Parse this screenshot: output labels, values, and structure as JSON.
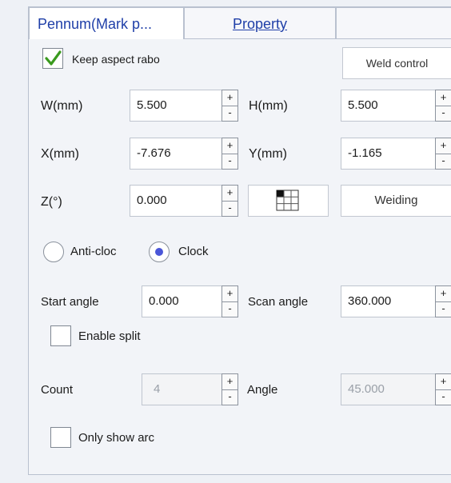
{
  "tabs": [
    "Pennum(Mark p...",
    "Property",
    ""
  ],
  "keep_aspect": {
    "label": "Keep aspect rabo",
    "checked": true
  },
  "weld_control": "Weld control",
  "fields": {
    "w": {
      "label": "W(mm)",
      "value": "5.500"
    },
    "h": {
      "label": "H(mm)",
      "value": "5.500"
    },
    "x": {
      "label": "X(mm)",
      "value": "-7.676"
    },
    "y": {
      "label": "Y(mm)",
      "value": "-1.165"
    },
    "z": {
      "label": "Z(°)",
      "value": "0.000"
    }
  },
  "welding_button": "Weiding",
  "direction": {
    "anti_clock": {
      "label": "Anti-cloc",
      "selected": false
    },
    "clock": {
      "label": "Clock",
      "selected": true
    }
  },
  "start_angle": {
    "label": "Start angle",
    "value": "0.000"
  },
  "scan_angle": {
    "label": "Scan angle",
    "value": "360.000"
  },
  "enable_split": {
    "label": "Enable split",
    "checked": false
  },
  "count": {
    "label": "Count",
    "value": "4"
  },
  "angle": {
    "label": "Angle",
    "value": "45.000"
  },
  "only_show_arc": {
    "label": "Only show arc",
    "checked": false
  },
  "spin": {
    "up": "+",
    "down": "-"
  },
  "icons": {
    "check": "checkmark-icon",
    "grid": "grid-anchor-icon"
  },
  "colors": {
    "tab_text": "#1f3fa8",
    "check_green": "#3a9a1e",
    "radio_dot": "#4a56d8"
  }
}
